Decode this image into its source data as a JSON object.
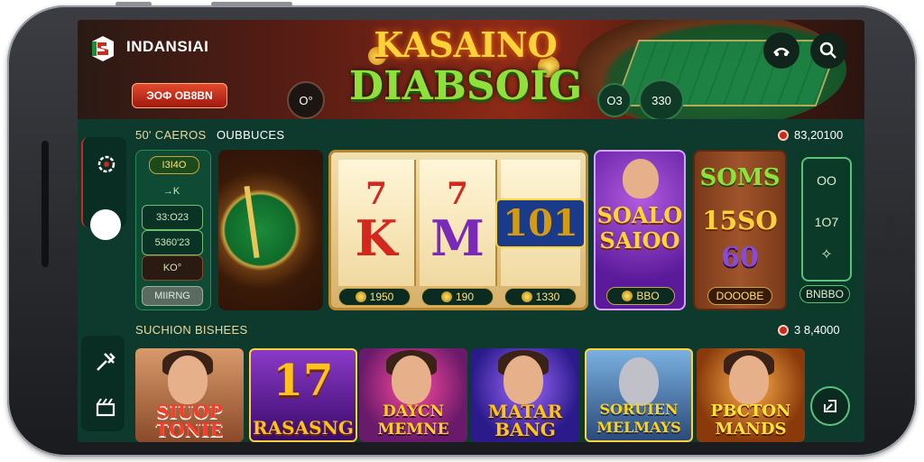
{
  "header": {
    "brand": "INDANSIAI",
    "title_line1": "KASAINO",
    "title_line2": "DIABSOIG",
    "red_button": "ЭOФ OB8BN",
    "circle_btn_left": "O°",
    "circle_btn_mid1": "O3",
    "circle_btn_mid2": "330"
  },
  "sections": {
    "top_left_label": "50' CAEROS",
    "top_mid_label": "OUBBUCES",
    "top_right_amount": "83,20100",
    "bottom_left_label": "SUCHION BISHEES",
    "bottom_right_amount": "3 8,4000"
  },
  "left_mini": {
    "badge": "I3I4O",
    "rows": [
      "→K",
      "33:O23",
      "5360'23",
      "KO°"
    ],
    "button": "MIIRNG"
  },
  "tiles": {
    "slot1_amount": "1950",
    "slot2_amount": "190",
    "slot3_amount": "1330",
    "purple_title1": "SOALO",
    "purple_title2": "SAIOO",
    "purple_amount": "BBO",
    "wood_title1": "SOMS",
    "wood_title2": "15SO",
    "wood_title3": "60",
    "wood_button": "DOOOBE",
    "right_value1": "OO",
    "right_value2": "1O7",
    "right_button": "BNBBO"
  },
  "reel_symbols": [
    {
      "top": "7",
      "main": "K",
      "color": "#d4281e"
    },
    {
      "top": "7",
      "main": "M",
      "color": "#7a2ab8"
    },
    {
      "top": "",
      "main": "101",
      "color": "#d49a12"
    }
  ],
  "game_cards": [
    {
      "title": "SIUOP TONIE",
      "bg": "#c97a4a",
      "text_color": "#ff3a2a"
    },
    {
      "title": "RASASNG",
      "bg": "#6a2a9a",
      "text_color": "#ffc21a",
      "big": "17"
    },
    {
      "title": "DAYCN MEMNE",
      "bg": "#7a1a6a",
      "text_color": "#ffd21a"
    },
    {
      "title": "MATAR BANG",
      "bg": "#4a2aa0",
      "text_color": "#ffc21a"
    },
    {
      "title": "SORUIEN MELMAYS",
      "bg": "#3a6a9a",
      "text_color": "#ffd21a"
    },
    {
      "title": "PBCTON MANDS",
      "bg": "#b8581a",
      "text_color": "#ffe23a"
    }
  ],
  "colors": {
    "panel": "#0d3a2d",
    "accent_gold": "#ffd23a",
    "accent_green": "#8fe03a",
    "accent_red": "#c8281d"
  },
  "icons": [
    "logo-icon",
    "share-icon",
    "search-icon",
    "settings-icon",
    "tools-icon",
    "clapper-icon",
    "shrink-icon",
    "coin-icon"
  ]
}
